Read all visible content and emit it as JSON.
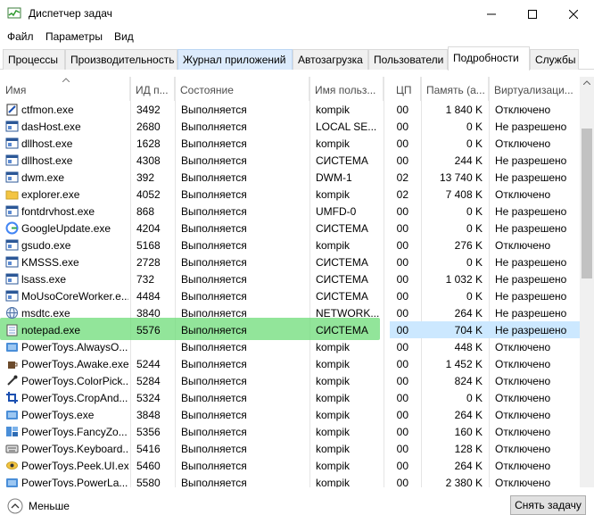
{
  "window": {
    "title": "Диспетчер задач",
    "minimize_glyph": "—",
    "maximize_glyph": "☐",
    "close_glyph": "✕"
  },
  "menu": [
    "Файл",
    "Параметры",
    "Вид"
  ],
  "tabs": [
    {
      "label": "Процессы"
    },
    {
      "label": "Производительность"
    },
    {
      "label": "Журнал приложений"
    },
    {
      "label": "Автозагрузка"
    },
    {
      "label": "Пользователи"
    },
    {
      "label": "Подробности"
    },
    {
      "label": "Службы"
    }
  ],
  "active_tab": "Подробности",
  "columns": [
    "Имя",
    "ИД п...",
    "Состояние",
    "Имя польз...",
    "ЦП",
    "Память (а...",
    "Виртуализаци..."
  ],
  "rows": [
    {
      "icon": "ctfmon-icon",
      "name": "ctfmon.exe",
      "pid": "3492",
      "status": "Выполняется",
      "user": "kompik",
      "cpu": "00",
      "mem": "1 840 K",
      "virt": "Отключено"
    },
    {
      "icon": "window-icon",
      "name": "dasHost.exe",
      "pid": "2680",
      "status": "Выполняется",
      "user": "LOCAL SE...",
      "cpu": "00",
      "mem": "0 K",
      "virt": "Не разрешено"
    },
    {
      "icon": "window-icon",
      "name": "dllhost.exe",
      "pid": "1628",
      "status": "Выполняется",
      "user": "kompik",
      "cpu": "00",
      "mem": "0 K",
      "virt": "Отключено"
    },
    {
      "icon": "window-icon",
      "name": "dllhost.exe",
      "pid": "4308",
      "status": "Выполняется",
      "user": "СИСТЕМА",
      "cpu": "00",
      "mem": "244 K",
      "virt": "Не разрешено"
    },
    {
      "icon": "window-icon",
      "name": "dwm.exe",
      "pid": "392",
      "status": "Выполняется",
      "user": "DWM-1",
      "cpu": "02",
      "mem": "13 740 K",
      "virt": "Не разрешено"
    },
    {
      "icon": "folder-icon",
      "name": "explorer.exe",
      "pid": "4052",
      "status": "Выполняется",
      "user": "kompik",
      "cpu": "02",
      "mem": "7 408 K",
      "virt": "Отключено"
    },
    {
      "icon": "window-icon",
      "name": "fontdrvhost.exe",
      "pid": "868",
      "status": "Выполняется",
      "user": "UMFD-0",
      "cpu": "00",
      "mem": "0 K",
      "virt": "Не разрешено"
    },
    {
      "icon": "google-icon",
      "name": "GoogleUpdate.exe",
      "pid": "4204",
      "status": "Выполняется",
      "user": "СИСТЕМА",
      "cpu": "00",
      "mem": "0 K",
      "virt": "Не разрешено"
    },
    {
      "icon": "window-icon",
      "name": "gsudo.exe",
      "pid": "5168",
      "status": "Выполняется",
      "user": "kompik",
      "cpu": "00",
      "mem": "276 K",
      "virt": "Отключено"
    },
    {
      "icon": "window-icon",
      "name": "KMSSS.exe",
      "pid": "2728",
      "status": "Выполняется",
      "user": "СИСТЕМА",
      "cpu": "00",
      "mem": "0 K",
      "virt": "Не разрешено"
    },
    {
      "icon": "window-icon",
      "name": "lsass.exe",
      "pid": "732",
      "status": "Выполняется",
      "user": "СИСТЕМА",
      "cpu": "00",
      "mem": "1 032 K",
      "virt": "Не разрешено"
    },
    {
      "icon": "window-icon",
      "name": "MoUsoCoreWorker.e...",
      "pid": "4484",
      "status": "Выполняется",
      "user": "СИСТЕМА",
      "cpu": "00",
      "mem": "0 K",
      "virt": "Не разрешено"
    },
    {
      "icon": "globe-icon",
      "name": "msdtc.exe",
      "pid": "3840",
      "status": "Выполняется",
      "user": "NETWORK...",
      "cpu": "00",
      "mem": "264 K",
      "virt": "Не разрешено"
    },
    {
      "icon": "notepad-icon",
      "name": "notepad.exe",
      "pid": "5576",
      "status": "Выполняется",
      "user": "СИСТЕМА",
      "cpu": "00",
      "mem": "704 K",
      "virt": "Не разрешено"
    },
    {
      "icon": "powertoys-icon",
      "name": "PowerToys.AlwaysO...",
      "pid": "",
      "status": "Выполняется",
      "user": "kompik",
      "cpu": "00",
      "mem": "448 K",
      "virt": "Отключено"
    },
    {
      "icon": "coffee-icon",
      "name": "PowerToys.Awake.exe",
      "pid": "5244",
      "status": "Выполняется",
      "user": "kompik",
      "cpu": "00",
      "mem": "1 452 K",
      "virt": "Отключено"
    },
    {
      "icon": "colorpicker-icon",
      "name": "PowerToys.ColorPick...",
      "pid": "5284",
      "status": "Выполняется",
      "user": "kompik",
      "cpu": "00",
      "mem": "824 K",
      "virt": "Отключено"
    },
    {
      "icon": "crop-icon",
      "name": "PowerToys.CropAnd...",
      "pid": "5324",
      "status": "Выполняется",
      "user": "kompik",
      "cpu": "00",
      "mem": "0 K",
      "virt": "Отключено"
    },
    {
      "icon": "powertoys-icon",
      "name": "PowerToys.exe",
      "pid": "3848",
      "status": "Выполняется",
      "user": "kompik",
      "cpu": "00",
      "mem": "264 K",
      "virt": "Отключено"
    },
    {
      "icon": "fancyzones-icon",
      "name": "PowerToys.FancyZo...",
      "pid": "5356",
      "status": "Выполняется",
      "user": "kompik",
      "cpu": "00",
      "mem": "160 K",
      "virt": "Отключено"
    },
    {
      "icon": "keyboard-icon",
      "name": "PowerToys.Keyboard...",
      "pid": "5416",
      "status": "Выполняется",
      "user": "kompik",
      "cpu": "00",
      "mem": "128 K",
      "virt": "Отключено"
    },
    {
      "icon": "peek-icon",
      "name": "PowerToys.Peek.UI.exe",
      "pid": "5460",
      "status": "Выполняется",
      "user": "kompik",
      "cpu": "00",
      "mem": "264 K",
      "virt": "Отключено"
    },
    {
      "icon": "powertoys-icon",
      "name": "PowerToys.PowerLa...",
      "pid": "5580",
      "status": "Выполняется",
      "user": "kompik",
      "cpu": "00",
      "mem": "2 380 K",
      "virt": "Отключено"
    }
  ],
  "footer": {
    "less_label": "Меньше",
    "end_task_label": "Снять задачу"
  },
  "colors": {
    "highlight": "#6edc78",
    "selected_row": "#cce8ff",
    "tab_hover": "#dcebfc"
  }
}
